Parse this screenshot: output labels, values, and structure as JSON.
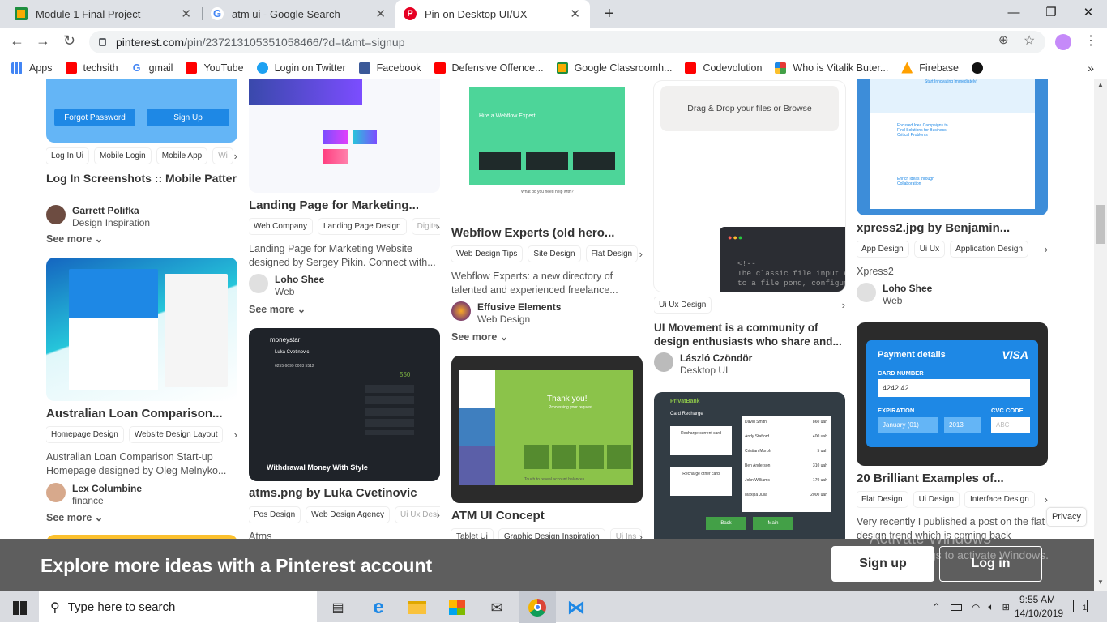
{
  "browser": {
    "tabs": [
      {
        "label": "Module 1 Final Project",
        "close": "✕"
      },
      {
        "label": "atm ui - Google Search",
        "close": "✕"
      },
      {
        "label": "Pin on Desktop UI/UX",
        "close": "✕"
      }
    ],
    "new_tab": "+",
    "window_controls": {
      "minimize": "—",
      "restore": "❐",
      "close": "✕"
    },
    "url_host": "pinterest.com",
    "url_path": "/pin/237213105351058466/?d=t&mt=signup",
    "bookmarks": [
      "Apps",
      "techsith",
      "gmail",
      "YouTube",
      "Login on Twitter",
      "Facebook",
      "Defensive Offence...",
      "Google Classroomh...",
      "Codevolution",
      "Who is Vitalik Buter...",
      "Firebase"
    ],
    "bookmarks_more": "»"
  },
  "pins": {
    "p1": {
      "img_buttons": [
        "Forgot Password",
        "Sign Up"
      ],
      "tags": [
        "Log In Ui",
        "Mobile Login",
        "Mobile App",
        "Wi"
      ],
      "title": "Log In Screenshots :: Mobile Patterns",
      "user": "Garrett Polifka",
      "board": "Design Inspiration",
      "see_more": "See more"
    },
    "p2": {
      "title": "Australian Loan Comparison...",
      "tags": [
        "Homepage Design",
        "Website Design Layout"
      ],
      "desc": "Australian Loan Comparison Start-up Homepage designed by Oleg Melnyko...",
      "user": "Lex Columbine",
      "board": "finance",
      "see_more": "See more"
    },
    "p3": {
      "title": "Landing Page for Marketing...",
      "tags": [
        "Web Company",
        "Landing Page Design",
        "Digita"
      ],
      "desc": "Landing Page for Marketing Website designed by Sergey Pikin. Connect with...",
      "user": "Loho Shee",
      "board": "Web",
      "see_more": "See more"
    },
    "p4": {
      "img_brand": "moneystar",
      "img_name": "Luka Cvetinovic",
      "img_card": "6255 6699 0003 5512",
      "img_amount": "550",
      "img_caption": "Withdrawal Money With Style",
      "title": "atms.png by Luka Cvetinovic",
      "tags": [
        "Pos Design",
        "Web Design Agency",
        "Ui Ux Desi"
      ],
      "desc": "Atms"
    },
    "p5": {
      "img_heading": "Hire a Webflow Expert",
      "img_sub": "What do you need help with?",
      "title": "Webflow Experts (old hero...",
      "tags": [
        "Web Design Tips",
        "Site Design",
        "Flat Design"
      ],
      "desc": "Webflow Experts: a new directory of talented and experienced freelance...",
      "user": "Effusive Elements",
      "board": "Web Design",
      "see_more": "See more"
    },
    "p6": {
      "img_thanks": "Thank you!",
      "img_processing": "Processing your request",
      "img_footer": "Touch to reveal account balances",
      "title": "ATM UI Concept",
      "tags": [
        "Tablet Ui",
        "Graphic Design Inspiration",
        "Ui Ins"
      ]
    },
    "p7": {
      "img_drop": "Drag & Drop your files or Browse",
      "img_code": "<!--\nThe classic file input el\nto a file pond, configur",
      "tags": [
        "Ui Ux Design"
      ],
      "title": "UI Movement is a community of design enthusiasts who share and...",
      "user": "László Czöndör",
      "board": "Desktop UI"
    },
    "p8": {
      "img_brand": "PrivatBank",
      "img_title": "Card Recharge",
      "img_opt1": "Recharge current card",
      "img_opt2": "Recharge other card",
      "img_back": "Back",
      "img_main": "Main",
      "img_rows": [
        {
          "name": "David Smith",
          "amt": "860 uah"
        },
        {
          "name": "Andy Stafford",
          "amt": "400 uah"
        },
        {
          "name": "Cristian Morph",
          "amt": "5 uah"
        },
        {
          "name": "Ben Anderson",
          "amt": "310 uah"
        },
        {
          "name": "John Williams",
          "amt": "170 uah"
        },
        {
          "name": "Maxipa Julia",
          "amt": "2000 uah"
        }
      ]
    },
    "p9": {
      "img_heading": "Start Innovating Immediately!",
      "img_text": "Focused Idea Campaigns to Find Solutions for Business Critical Problems",
      "img_text2": "Enrich ideas through Collaboration",
      "title": "xpress2.jpg by Benjamin...",
      "tags": [
        "App Design",
        "Ui Ux",
        "Application Design"
      ],
      "desc": "Xpress2",
      "user": "Loho Shee",
      "board": "Web"
    },
    "p10": {
      "img_title": "Payment details",
      "img_brand": "VISA",
      "img_card_label": "CARD NUMBER",
      "img_card_value": "4242 42",
      "img_exp_label": "EXPIRATION",
      "img_cvc_label": "CVC CODE",
      "img_month": "January (01)",
      "img_year": "2013",
      "img_cvc_ph": "ABC",
      "title": "20 Brilliant Examples of...",
      "tags": [
        "Flat Design",
        "Ui Design",
        "Interface Design"
      ],
      "desc": "Very recently I published a post on the flat design trend which is coming back"
    }
  },
  "banner": {
    "text": "Explore more ideas with a Pinterest account",
    "signup": "Sign up",
    "login": "Log in",
    "watermark1": "Activate Windows",
    "watermark2": "Go to Settings to activate Windows."
  },
  "privacy": "Privacy",
  "taskbar": {
    "search_placeholder": "Type here to search",
    "time": "9:55 AM",
    "date": "14/10/2019",
    "notif_count": "1"
  }
}
